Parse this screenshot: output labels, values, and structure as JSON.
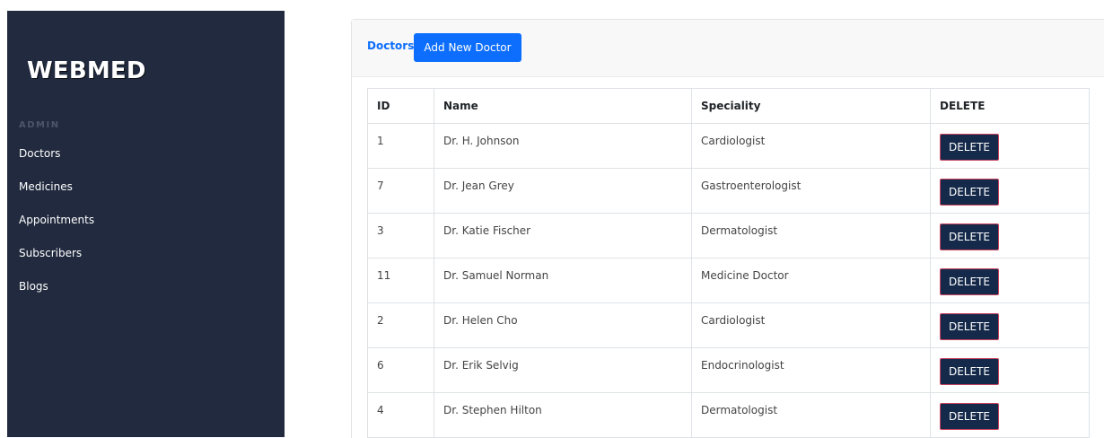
{
  "sidebar": {
    "brand": "WEBMED",
    "section_label": "ADMIN",
    "items": [
      {
        "label": "Doctors"
      },
      {
        "label": "Medicines"
      },
      {
        "label": "Appointments"
      },
      {
        "label": "Subscribers"
      },
      {
        "label": "Blogs"
      }
    ]
  },
  "header": {
    "title": "Doctors",
    "add_button_label": "Add New Doctor"
  },
  "table": {
    "columns": [
      "ID",
      "Name",
      "Speciality",
      "DELETE"
    ],
    "delete_label": "DELETE",
    "rows": [
      {
        "id": "1",
        "name": "Dr. H. Johnson",
        "speciality": "Cardiologist"
      },
      {
        "id": "7",
        "name": "Dr. Jean Grey",
        "speciality": "Gastroenterologist"
      },
      {
        "id": "3",
        "name": "Dr. Katie Fischer",
        "speciality": "Dermatologist"
      },
      {
        "id": "11",
        "name": "Dr. Samuel Norman",
        "speciality": "Medicine Doctor"
      },
      {
        "id": "2",
        "name": "Dr. Helen Cho",
        "speciality": "Cardiologist"
      },
      {
        "id": "6",
        "name": "Dr. Erik Selvig",
        "speciality": "Endocrinologist"
      },
      {
        "id": "4",
        "name": "Dr. Stephen Hilton",
        "speciality": "Dermatologist"
      }
    ]
  },
  "colors": {
    "sidebar_bg": "#212a3e",
    "accent": "#0d6efd",
    "delete_button_bg": "#152a4a",
    "delete_button_border": "#c7415c"
  }
}
